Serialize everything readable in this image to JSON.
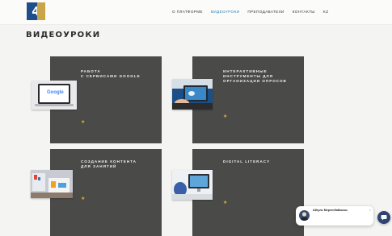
{
  "nav": {
    "logo": "4",
    "items": [
      {
        "label": "О платформе",
        "active": false
      },
      {
        "label": "Видеоуроки",
        "active": true
      },
      {
        "label": "Преподаватели",
        "active": false
      },
      {
        "label": "Контакты",
        "active": false
      },
      {
        "label": "KZ",
        "active": false
      }
    ]
  },
  "page": {
    "title": "ВИДЕОУРОКИ"
  },
  "cards": [
    {
      "title_line1": "РАБОТА",
      "title_line2": "С СЕРВИСАМИ GOOGLE",
      "description": "",
      "thumb_label": "Google"
    },
    {
      "title_line1": "ИНТЕРАКТИВНЫЕ",
      "title_line2": "ИНСТРУМЕНТЫ ДЛЯ",
      "title_line3": "ОРГАНИЗАЦИИ ОПРОСОВ",
      "description": ""
    },
    {
      "title_line1": "СОЗДАНИЕ КОНТЕНТА",
      "title_line2": "ДЛЯ ЗАНЯТИЙ",
      "description": ""
    },
    {
      "title_line1": "DIGITAL LITERACY",
      "description": ""
    }
  ],
  "chat": {
    "name": "Айгуль Мергенбайкызы",
    "message": "",
    "close": "×"
  },
  "colors": {
    "card_bg": "#4a4a48",
    "accent_link": "#23a5a5",
    "star": "#e0b21a",
    "nav_active": "#2a7fb0"
  }
}
